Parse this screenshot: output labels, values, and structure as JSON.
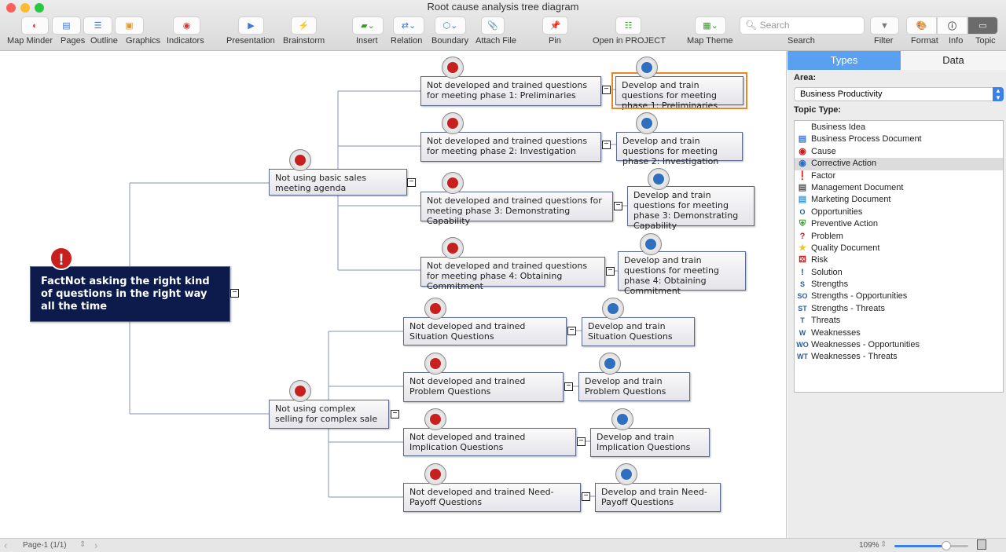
{
  "window": {
    "title": "Root cause analysis tree diagram"
  },
  "toolbar": {
    "map_minder": "Map Minder",
    "pages": "Pages",
    "outline": "Outline",
    "graphics": "Graphics",
    "indicators": "Indicators",
    "presentation": "Presentation",
    "brainstorm": "Brainstorm",
    "insert": "Insert",
    "relation": "Relation",
    "boundary": "Boundary",
    "attach_file": "Attach File",
    "pin": "Pin",
    "open_project": "Open in PROJECT",
    "map_theme": "Map Theme",
    "search_placeholder": "Search",
    "search": "Search",
    "filter": "Filter",
    "format": "Format",
    "info": "Info",
    "topic": "Topic"
  },
  "map": {
    "root": "FactNot asking the right kind of questions in the right way all the time",
    "branches": [
      {
        "label": "Not using basic sales meeting agenda",
        "children": [
          {
            "cause": "Not developed and trained questions for meeting phase 1: Preliminaries",
            "action": "Develop and train questions for meeting phase 1: Preliminaries",
            "selected": true
          },
          {
            "cause": "Not developed and trained questions for meeting phase 2: Investigation",
            "action": "Develop and train questions for meeting phase 2: Investigation"
          },
          {
            "cause": "Not developed and trained questions for meeting phase 3: Demonstrating Capability",
            "action": "Develop and train questions for meeting phase 3: Demonstrating Capability"
          },
          {
            "cause": "Not developed and trained questions for meeting phase 4: Obtaining Commitment",
            "action": "Develop and train questions for meeting phase 4: Obtaining Commitment"
          }
        ]
      },
      {
        "label": "Not using complex selling for complex sale",
        "children": [
          {
            "cause": "Not developed and trained Situation Questions",
            "action": "Develop and train Situation Questions"
          },
          {
            "cause": "Not developed and trained Problem Questions",
            "action": "Develop and train Problem Questions"
          },
          {
            "cause": "Not developed and trained Implication Questions",
            "action": "Develop and train Implication Questions"
          },
          {
            "cause": "Not developed and trained Need-Payoff Questions",
            "action": "Develop and train Need-Payoff Questions"
          }
        ]
      }
    ]
  },
  "panel": {
    "tabs": [
      "Types",
      "Data"
    ],
    "active_tab": "Types",
    "area_label": "Area:",
    "area_value": "Business Productivity",
    "topic_type_label": "Topic Type:",
    "topic_types": [
      {
        "label": "Business Idea",
        "icon": ""
      },
      {
        "label": "Business Process Document",
        "icon": "document-chart-icon"
      },
      {
        "label": "Cause",
        "icon": "red-dot-icon"
      },
      {
        "label": "Corrective Action",
        "icon": "blue-dot-icon",
        "selected": true
      },
      {
        "label": "Factor",
        "icon": "red-exclamation-icon"
      },
      {
        "label": "Management Document",
        "icon": "document-person-icon"
      },
      {
        "label": "Marketing Document",
        "icon": "document-marketing-icon"
      },
      {
        "label": "Opportunities",
        "icon": "O"
      },
      {
        "label": "Preventive Action",
        "icon": "green-shield-icon"
      },
      {
        "label": "Problem",
        "icon": "red-question-icon"
      },
      {
        "label": "Quality Document",
        "icon": "document-star-icon"
      },
      {
        "label": "Risk",
        "icon": "dice-icon"
      },
      {
        "label": "Solution",
        "icon": "blue-exclamation-icon"
      },
      {
        "label": "Strengths",
        "icon": "S"
      },
      {
        "label": "Strengths - Opportunities",
        "icon": "SO"
      },
      {
        "label": "Strengths - Threats",
        "icon": "ST"
      },
      {
        "label": "Threats",
        "icon": "T"
      },
      {
        "label": "Weaknesses",
        "icon": "W"
      },
      {
        "label": "Weaknesses - Opportunities",
        "icon": "WO"
      },
      {
        "label": "Weaknesses - Threats",
        "icon": "WT"
      }
    ]
  },
  "status": {
    "page": "Page-1 (1/1)",
    "zoom": "109%",
    "zoom_slider": 0.7
  },
  "colors": {
    "cause": "#c8201e",
    "action": "#2f6fc0",
    "root": "#0c1a4c",
    "selected": "#e8862a",
    "accent": "#5aa0f0"
  }
}
